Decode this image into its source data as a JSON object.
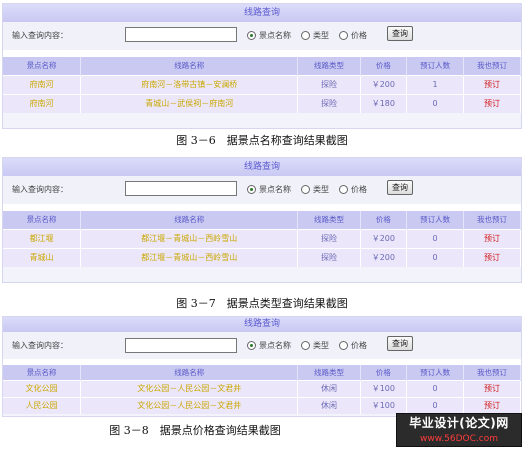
{
  "panels": [
    {
      "title": "线路查询",
      "search": {
        "label": "输入查询内容：",
        "value": "",
        "options": [
          "景点名称",
          "类型",
          "价格"
        ],
        "selected": "景点名称",
        "button": "查询"
      },
      "table": {
        "headers": [
          "景点名称",
          "线路名称",
          "线路类型",
          "价格",
          "预订人数",
          "我也预订"
        ],
        "rows": [
          [
            "府南河",
            "府南河－洛带古镇－安澜桥",
            "探险",
            "￥200",
            "1",
            "预订"
          ],
          [
            "府南河",
            "青城山－武侯祠－府南河",
            "探险",
            "￥180",
            "0",
            "预订"
          ]
        ]
      },
      "caption": "图 3－6　据景点名称查询结果截图"
    },
    {
      "title": "线路查询",
      "search": {
        "label": "输入查询内容：",
        "value": "",
        "options": [
          "景点名称",
          "类型",
          "价格"
        ],
        "selected": "景点名称",
        "button": "查询"
      },
      "table": {
        "headers": [
          "景点名称",
          "线路名称",
          "线路类型",
          "价格",
          "预订人数",
          "我也预订"
        ],
        "rows": [
          [
            "都江堰",
            "都江堰－青城山－西岭雪山",
            "探险",
            "￥200",
            "0",
            "预订"
          ],
          [
            "青城山",
            "都江堰－青城山－西岭雪山",
            "探险",
            "￥200",
            "0",
            "预订"
          ]
        ]
      },
      "caption": "图 3－7　据景点类型查询结果截图"
    },
    {
      "title": "线路查询",
      "search": {
        "label": "输入查询内容：",
        "value": "",
        "options": [
          "景点名称",
          "类型",
          "价格"
        ],
        "selected": "景点名称",
        "button": "查询"
      },
      "table": {
        "headers": [
          "景点名称",
          "线路名称",
          "线路类型",
          "价格",
          "预订人数",
          "我也预订"
        ],
        "rows": [
          [
            "文化公园",
            "文化公园－人民公园－文君井",
            "休闲",
            "￥100",
            "0",
            "预订"
          ],
          [
            "人民公园",
            "文化公园－人民公园－文君井",
            "休闲",
            "￥100",
            "0",
            "预订"
          ]
        ]
      },
      "caption": "图 3－8　据景点价格查询结果截图"
    }
  ],
  "watermark": {
    "title": "毕业设计(论文)网",
    "url": "www.56DOC.com"
  },
  "colors": {
    "header_bg": "#c9c9f2",
    "row_bg": "#ece6fa",
    "yellow_text": "#c9a800",
    "book_red": "#d11a1a",
    "title_blue": "#5b5bd0"
  }
}
